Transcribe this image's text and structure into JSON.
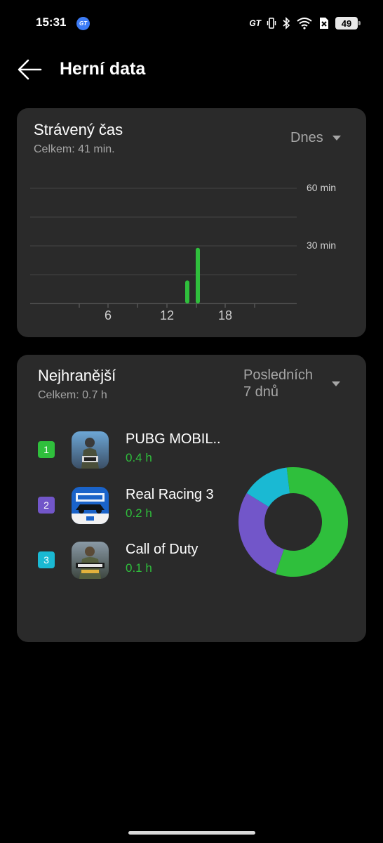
{
  "status_bar": {
    "time": "15:31",
    "badge_text": "GT",
    "gt_text": "GT",
    "battery": "49"
  },
  "header": {
    "title": "Herní data",
    "back_icon": "arrow-left-icon"
  },
  "time_card": {
    "title": "Strávený čas",
    "subtitle": "Celkem: 41 min.",
    "period": "Dnes",
    "chart_data": {
      "type": "bar",
      "title": "",
      "xlabel": "",
      "ylabel": "",
      "x_ticks": [
        "6",
        "12",
        "18"
      ],
      "y_ticks": [
        "60 min",
        "30 min"
      ],
      "ylim": [
        0,
        60
      ],
      "xlim": [
        0,
        24
      ],
      "grid": true,
      "bar_color": "#2fbf3c",
      "bars": [
        {
          "hour": 14,
          "minutes": 12
        },
        {
          "hour": 15,
          "minutes": 29
        }
      ]
    }
  },
  "top_card": {
    "title": "Nejhranější",
    "subtitle": "Celkem: 0.7 h",
    "period_line1": "Posledních",
    "period_line2": "7 dnů",
    "items": [
      {
        "rank": "1",
        "name": "PUBG MOBIL..",
        "hours": "0.4 h",
        "color": "#2fbf3c",
        "icon": "pubg-mobile-app-icon"
      },
      {
        "rank": "2",
        "name": "Real Racing 3",
        "hours": "0.2 h",
        "color": "#7256c9",
        "icon": "real-racing-3-app-icon"
      },
      {
        "rank": "3",
        "name": "Call of Duty",
        "hours": "0.1 h",
        "color": "#1ab9d3",
        "icon": "call-of-duty-app-icon"
      }
    ],
    "chart_data": {
      "type": "pie",
      "donut": true,
      "slices": [
        {
          "label": "PUBG MOBIL..",
          "value": 0.4,
          "color": "#2fbf3c"
        },
        {
          "label": "Real Racing 3",
          "value": 0.2,
          "color": "#7256c9"
        },
        {
          "label": "Call of Duty",
          "value": 0.1,
          "color": "#1ab9d3"
        }
      ]
    }
  }
}
